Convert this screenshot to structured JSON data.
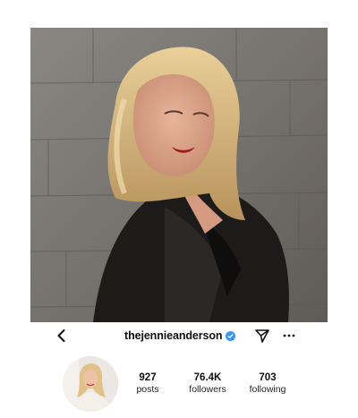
{
  "profile": {
    "username": "thejennieanderson",
    "verified_color": "#3897f0"
  },
  "icons": {
    "back": "chevron-left-icon",
    "verified": "verified-badge-icon",
    "send": "paper-plane-icon",
    "more": "more-horizontal-icon"
  },
  "stats": {
    "posts": {
      "value": "927",
      "label": "posts"
    },
    "followers": {
      "value": "76.4K",
      "label": "followers"
    },
    "following": {
      "value": "703",
      "label": "following"
    }
  }
}
